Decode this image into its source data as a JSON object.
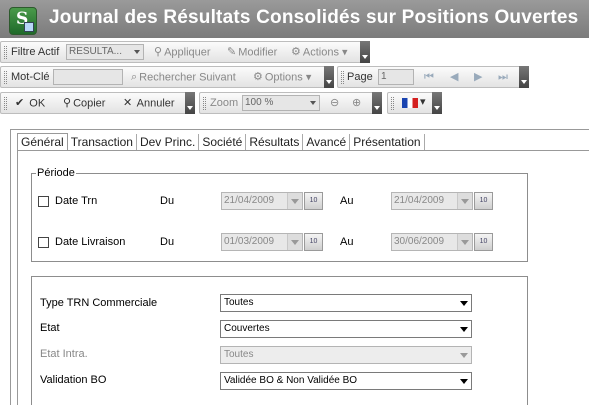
{
  "window": {
    "title": "Journal des Résultats Consolidés sur Positions Ouvertes",
    "app_icon_letter": "S"
  },
  "toolbar1": {
    "filter_label": "Filtre Actif",
    "filter_value": "RESULTA...",
    "apply_label": "Appliquer",
    "modify_label": "Modifier",
    "actions_label": "Actions"
  },
  "toolbar2": {
    "keyword_label": "Mot-Clé",
    "keyword_value": "",
    "search_next_label": "Rechercher Suivant",
    "options_label": "Options",
    "page_label": "Page",
    "page_value": "1"
  },
  "toolbar3": {
    "ok_label": "OK",
    "copy_label": "Copier",
    "cancel_label": "Annuler",
    "zoom_label": "Zoom",
    "zoom_value": "100 %"
  },
  "tabs": [
    "Général",
    "Transaction",
    "Dev Princ.",
    "Société",
    "Résultats",
    "Avancé",
    "Présentation"
  ],
  "period": {
    "legend": "Période",
    "rows": [
      {
        "label": "Date Trn",
        "from_label": "Du",
        "from": "21/04/2009",
        "to_label": "Au",
        "to": "21/04/2009",
        "checked": false
      },
      {
        "label": "Date Livraison",
        "from_label": "Du",
        "from": "01/03/2009",
        "to_label": "Au",
        "to": "30/06/2009",
        "checked": false
      }
    ]
  },
  "criteria": [
    {
      "label": "Type TRN Commerciale",
      "value": "Toutes",
      "enabled": true
    },
    {
      "label": "Etat",
      "value": "Couvertes",
      "enabled": true
    },
    {
      "label": "Etat Intra.",
      "value": "Toutes",
      "enabled": false
    },
    {
      "label": "Validation BO",
      "value": "Validée BO & Non Validée BO",
      "enabled": true
    }
  ],
  "calendar_icon_text": "10",
  "colors": {
    "titlebar": "#8a8a8a",
    "title_text": "#ffffff",
    "panel_border": "#999999"
  }
}
